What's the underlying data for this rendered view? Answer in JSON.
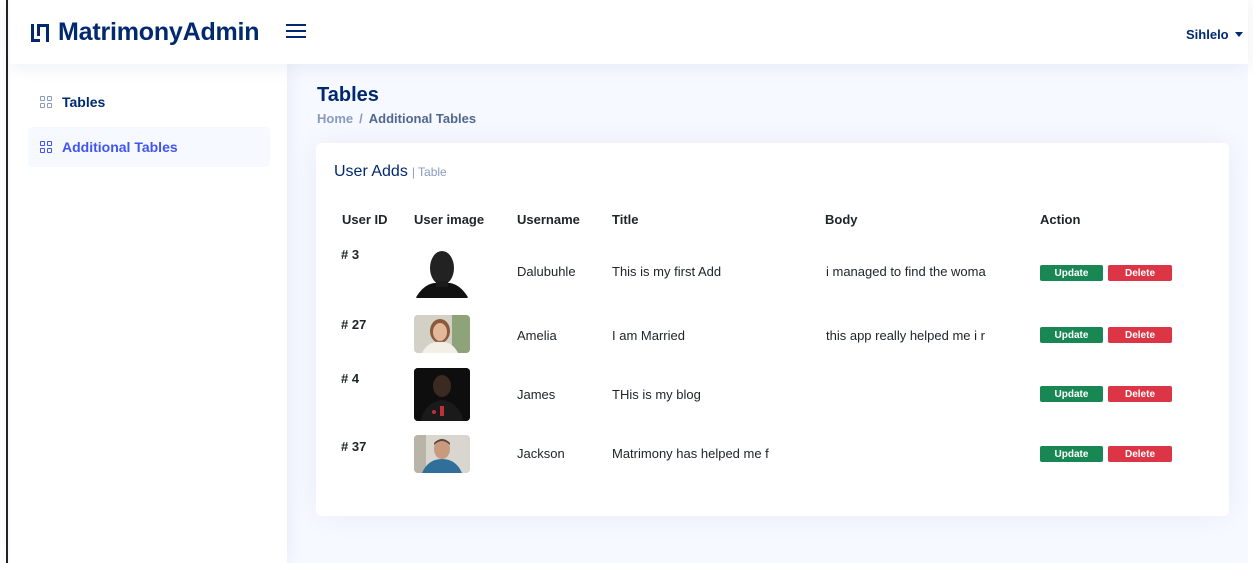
{
  "app": {
    "logo_text": "MatrimonyAdmin"
  },
  "header": {
    "user_name": "Sihlelo"
  },
  "sidebar": {
    "items": [
      {
        "label": "Tables",
        "icon": "grid-icon",
        "active": false
      },
      {
        "label": "Additional Tables",
        "icon": "grid-icon",
        "active": true
      }
    ]
  },
  "page": {
    "title": "Tables",
    "breadcrumb": {
      "home": "Home",
      "separator": "/",
      "current": "Additional Tables"
    }
  },
  "card": {
    "title": "User Adds",
    "subtitle": "| Table"
  },
  "table": {
    "headers": [
      "User ID",
      "User image",
      "Username",
      "Title",
      "Body",
      "Action"
    ],
    "rows": [
      {
        "id": "# 3",
        "image": "user-photo-icon",
        "username": "Dalubuhle",
        "title": "This is my first Add",
        "body": "i managed to find the woma",
        "update": "Update",
        "delete": "Delete"
      },
      {
        "id": "# 27",
        "image": "user-photo-icon",
        "username": "Amelia",
        "title": "I am Married",
        "body": "this app really helped me i r",
        "update": "Update",
        "delete": "Delete"
      },
      {
        "id": "# 4",
        "image": "user-photo-icon",
        "username": "James",
        "title": "THis is my blog",
        "body": "",
        "update": "Update",
        "delete": "Delete"
      },
      {
        "id": "# 37",
        "image": "user-photo-icon",
        "username": "Jackson",
        "title": "Matrimony has helped me f",
        "body": "",
        "update": "Update",
        "delete": "Delete"
      }
    ]
  },
  "colors": {
    "brand": "#012970",
    "accent": "#4154f1",
    "update": "#198754",
    "delete": "#dc3545",
    "background": "#f6f9ff"
  }
}
